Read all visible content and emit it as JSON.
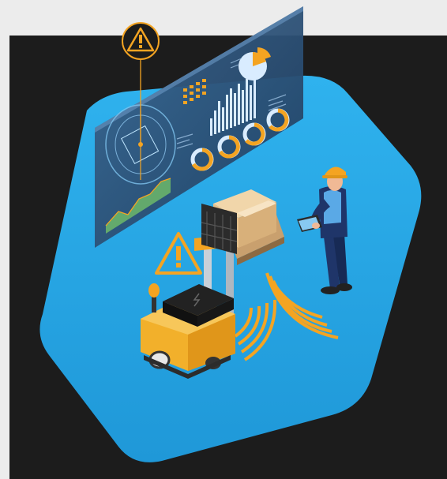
{
  "scene": {
    "subject": "autonomous-forklift-warehouse-safety-illustration",
    "colors": {
      "page_background": "#ececec",
      "dark_panel": "#1c1c1c",
      "hexagon_blue": "#29a9e6",
      "screen_glass": "#2c4f73",
      "accent_orange": "#f4a422",
      "forklift_yellow": "#f2b02b",
      "worker_navy": "#1f3569"
    },
    "icons": [
      "warning-icon",
      "target-icon",
      "bar-chart",
      "pie-chart",
      "donut-gauges",
      "sensor-waves",
      "cardboard-boxes",
      "tablet"
    ]
  }
}
